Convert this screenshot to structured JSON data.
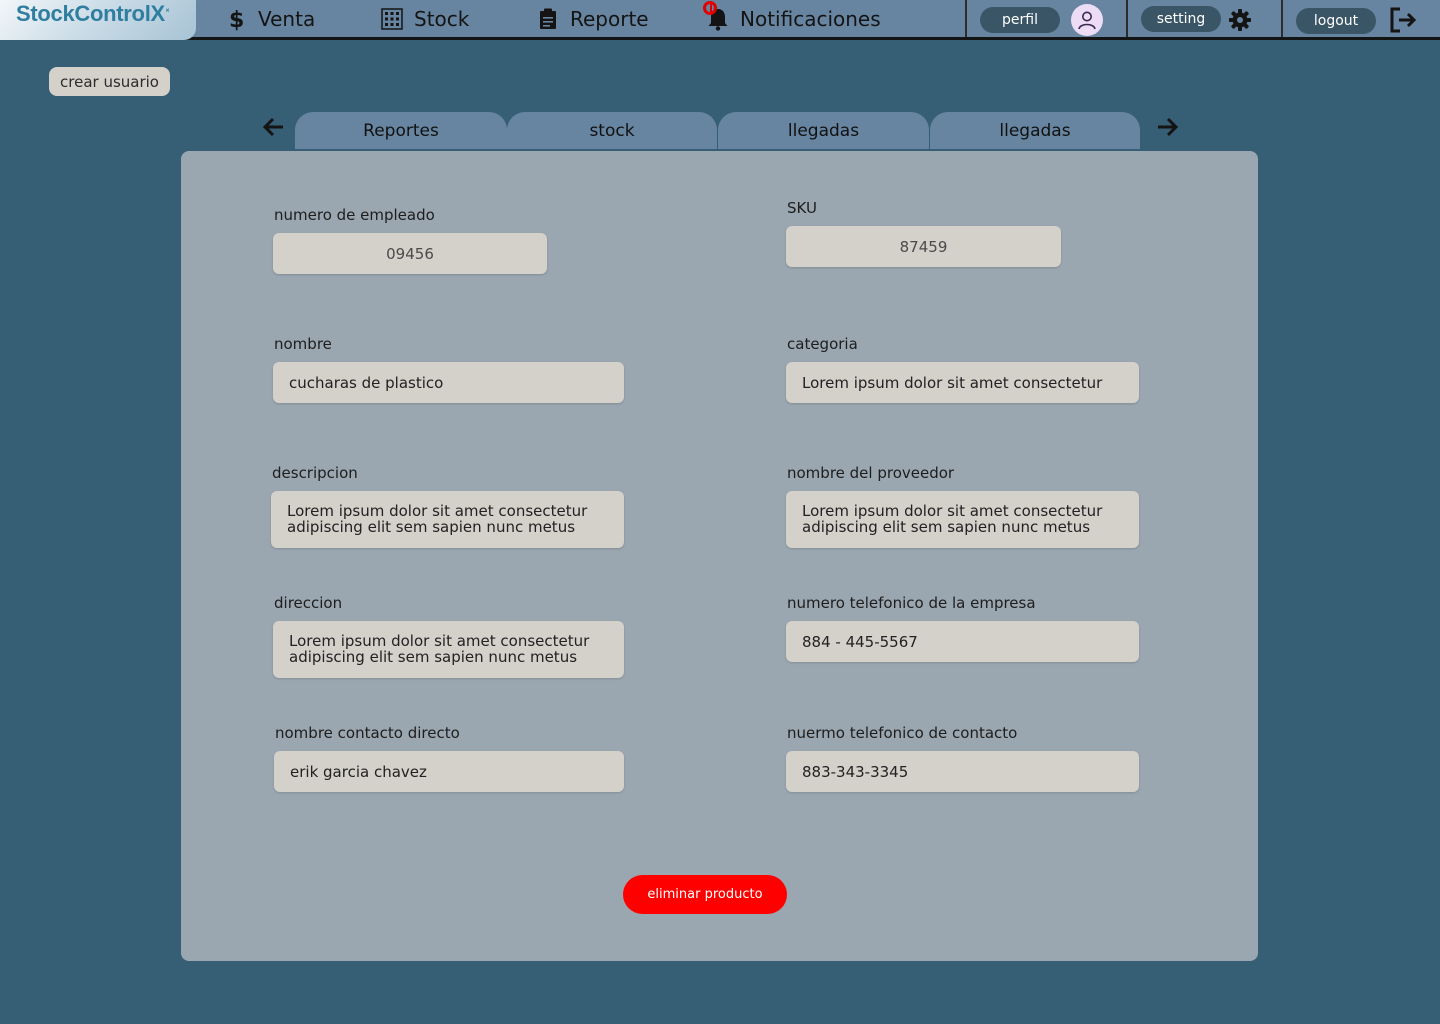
{
  "app": {
    "logo_text": "StockControlX",
    "logo_mark": "˟"
  },
  "nav": {
    "venta": "Venta",
    "stock": "Stock",
    "reporte": "Reporte",
    "notificaciones": "Notificaciones",
    "perfil": "perfil",
    "setting": "setting",
    "logout": "logout"
  },
  "actions": {
    "crear_usuario": "crear usuario",
    "eliminar_producto": "eliminar producto"
  },
  "tabs": [
    {
      "label": "Reportes"
    },
    {
      "label": "stock"
    },
    {
      "label": "llegadas"
    },
    {
      "label": "llegadas"
    }
  ],
  "form": {
    "numero_empleado": {
      "label": "numero de empleado",
      "value": "09456"
    },
    "sku": {
      "label": "SKU",
      "value": "87459"
    },
    "nombre": {
      "label": "nombre",
      "value": "cucharas de plastico"
    },
    "categoria": {
      "label": "categoria",
      "value": "Lorem ipsum dolor sit amet consectetur"
    },
    "descripcion": {
      "label": "descripcion",
      "value": "Lorem ipsum dolor sit amet consectetur\nadipiscing elit sem sapien nunc metus"
    },
    "nombre_proveedor": {
      "label": "nombre del proveedor",
      "value": "Lorem ipsum dolor sit amet consectetur\nadipiscing elit sem sapien nunc metus"
    },
    "direccion": {
      "label": "direccion",
      "value": "Lorem ipsum dolor sit amet consectetur\nadipiscing elit sem sapien nunc metus"
    },
    "telefono_empresa": {
      "label": "numero telefonico de la empresa",
      "value": "884 - 445-5567"
    },
    "contacto_directo": {
      "label": "nombre contacto directo",
      "value": "erik garcia chavez"
    },
    "telefono_contacto": {
      "label": "nuermo telefonico de contacto",
      "value": "883-343-3345"
    }
  },
  "colors": {
    "background": "#365f76",
    "topbar": "#6785a0",
    "panel": "#9aa6b0",
    "field": "#d4d0ca",
    "danger": "#ff0000",
    "pill": "#3a5566",
    "notification_badge": "#e00000"
  },
  "icons": {
    "venta": "dollar-icon",
    "stock": "grid-icon",
    "reporte": "clipboard-icon",
    "notificaciones": "bell-icon",
    "perfil": "user-avatar-icon",
    "setting": "gear-icon",
    "logout": "logout-icon",
    "prev": "arrow-left-icon",
    "next": "arrow-right-icon"
  }
}
